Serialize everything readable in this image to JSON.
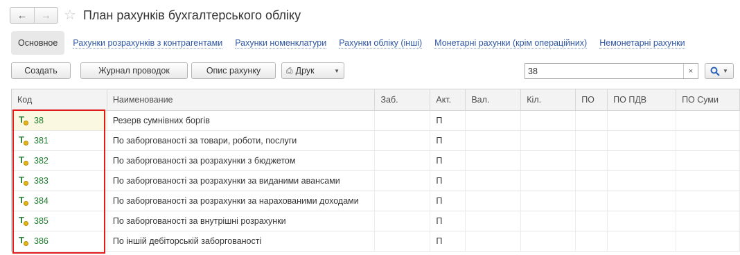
{
  "window": {
    "title": "План рахунків бухгалтерського обліку",
    "back_icon": "←",
    "forward_icon": "→",
    "favorite_icon": "☆"
  },
  "tabs": {
    "active": "Основное",
    "links": [
      "Рахунки розрахунків з контрагентами",
      "Рахунки номенклатури",
      "Рахунки обліку (інші)",
      "Монетарні рахунки (крім операційних)",
      "Немонетарні рахунки"
    ]
  },
  "toolbar": {
    "create_label": "Создать",
    "journal_label": "Журнал проводок",
    "account_desc_label": "Опис рахунку",
    "print_label": "Друк",
    "search_value": "38",
    "clear_icon": "×"
  },
  "table": {
    "columns": [
      "Код",
      "Наименование",
      "Заб.",
      "Акт.",
      "Вал.",
      "Кіл.",
      "ПО",
      "ПО ПДВ",
      "ПО Суми"
    ],
    "rows": [
      {
        "code": "38",
        "name": "Резерв сумнівних боргів",
        "zab": "",
        "akt": "П"
      },
      {
        "code": "381",
        "name": "По заборгованості за товари, роботи, послуги",
        "zab": "",
        "akt": "П"
      },
      {
        "code": "382",
        "name": "По заборгованості за розрахунки з бюджетом",
        "zab": "",
        "akt": "П"
      },
      {
        "code": "383",
        "name": "По заборгованості за розрахунки за виданими авансами",
        "zab": "",
        "akt": "П"
      },
      {
        "code": "384",
        "name": "По заборгованості за розрахунки за нарахованими доходами",
        "zab": "",
        "akt": "П"
      },
      {
        "code": "385",
        "name": "По заборгованості за внутрішні розрахунки",
        "zab": "",
        "akt": "П"
      },
      {
        "code": "386",
        "name": "По іншій дебіторській заборгованості",
        "zab": "",
        "akt": "П"
      }
    ],
    "row_icon_letter": "T"
  },
  "colors": {
    "highlight_border": "#e01b1b",
    "link": "#2f57a4",
    "code_text": "#1f7a2e"
  }
}
